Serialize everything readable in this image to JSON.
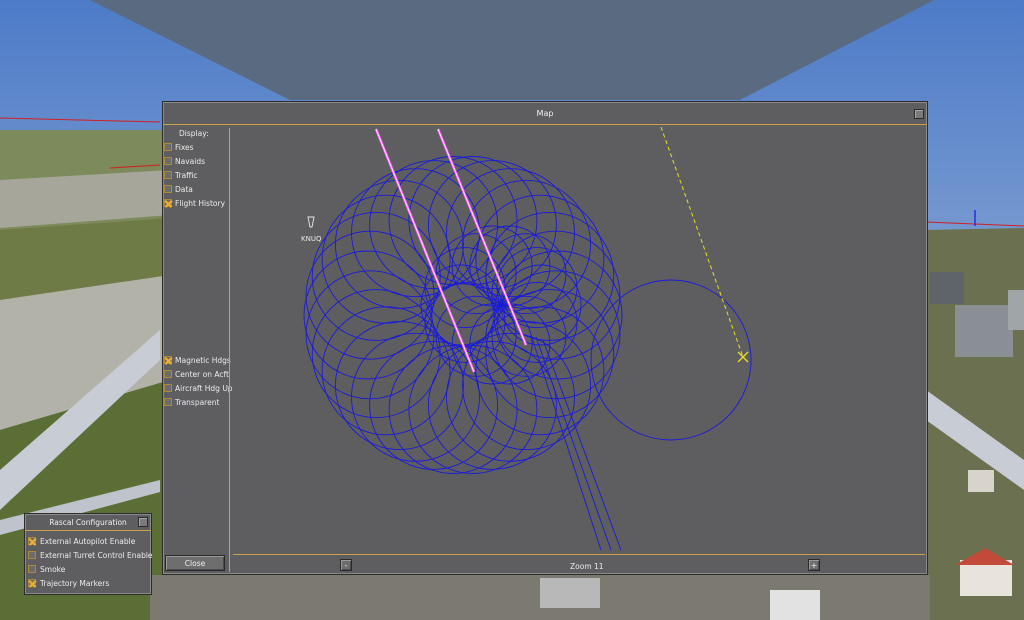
{
  "map": {
    "title": "Map",
    "display_label": "Display:",
    "display_options": [
      {
        "label": "Fixes",
        "checked": false
      },
      {
        "label": "Navaids",
        "checked": false
      },
      {
        "label": "Traffic",
        "checked": false
      },
      {
        "label": "Data",
        "checked": false
      },
      {
        "label": "Flight History",
        "checked": true
      }
    ],
    "view_options": [
      {
        "label": "Magnetic Hdgs",
        "checked": true
      },
      {
        "label": "Center on Acft",
        "checked": false
      },
      {
        "label": "Aircraft Hdg Up",
        "checked": false
      },
      {
        "label": "Transparent",
        "checked": false
      }
    ],
    "close_label": "Close",
    "zoom_out_label": "-",
    "zoom_in_label": "+",
    "zoom_label": "Zoom 11",
    "airport_label": "KNUQ",
    "colors": {
      "track": "#1a1ad8",
      "runway": "#ff66ff",
      "aircraft": "#e8e020",
      "accent": "#c8a34a"
    }
  },
  "rascal": {
    "title": "Rascal Configuration",
    "options": [
      {
        "label": "External Autopilot Enable",
        "checked": true
      },
      {
        "label": "External Turret Control Enable",
        "checked": false
      },
      {
        "label": "Smoke",
        "checked": false
      },
      {
        "label": "Trajectory Markers",
        "checked": true
      }
    ]
  }
}
